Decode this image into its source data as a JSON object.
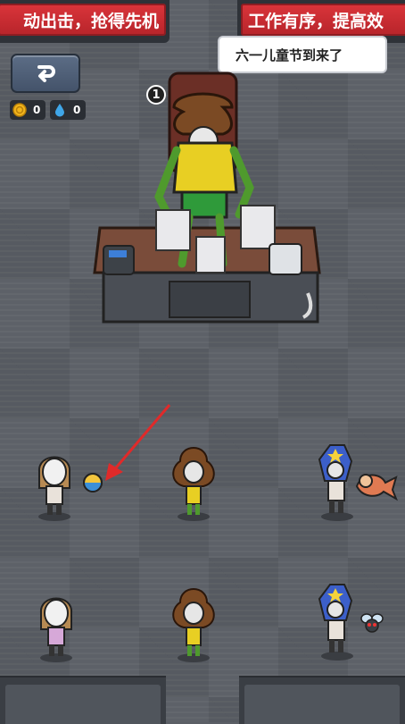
{
  "banners": {
    "left_text": "动出击，抢得先机",
    "right_text": "工作有序，提高效"
  },
  "back_button": {
    "icon": "return-arrow-icon"
  },
  "resources": {
    "coins": {
      "icon": "coin-icon",
      "value": "0"
    },
    "water": {
      "icon": "water-drop-icon",
      "value": "0"
    }
  },
  "speech_bubble": {
    "text": "六一儿童节到来了"
  },
  "boss": {
    "level": "1",
    "health_fraction": 1.0,
    "character": "poop-head-boss-icon"
  },
  "colors": {
    "banner_red": "#c52a30",
    "button_blue": "#4b5b73",
    "floor": "#5d6168",
    "health_red": "#e23b3b",
    "arrow_red": "#e02a2a"
  },
  "workers": [
    {
      "name": "girl-worker-icon"
    },
    {
      "name": "poop-worker-icon"
    },
    {
      "name": "ultraman-worker-icon"
    },
    {
      "name": "girl-worker-icon"
    },
    {
      "name": "poop-worker-icon"
    },
    {
      "name": "ultraman-worker-icon"
    }
  ],
  "items": [
    {
      "name": "ball-icon"
    },
    {
      "name": "pointer-arrow-icon"
    },
    {
      "name": "cat-fish-pet-icon"
    },
    {
      "name": "fly-pet-icon"
    }
  ]
}
